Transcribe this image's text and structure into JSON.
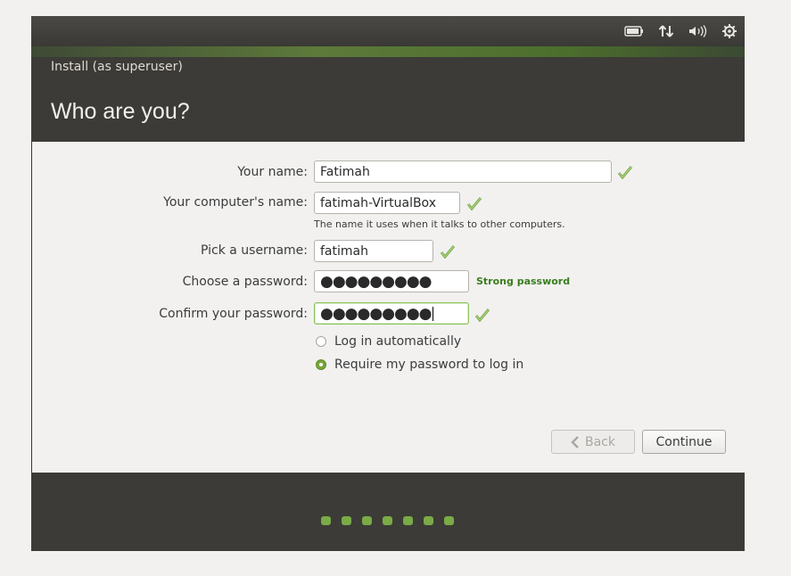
{
  "window": {
    "title": "Install (as superuser)"
  },
  "page": {
    "title": "Who are you?"
  },
  "indicators": {
    "battery": "battery-icon",
    "network": "network-updown-icon",
    "volume": "volume-icon",
    "settings": "gear-icon"
  },
  "form": {
    "your_name_label": "Your name:",
    "your_name_value": "Fatimah",
    "computer_name_label": "Your computer's name:",
    "computer_name_value": "fatimah-VirtualBox",
    "computer_name_hint": "The name it uses when it talks to other computers.",
    "username_label": "Pick a username:",
    "username_value": "fatimah",
    "password_label": "Choose a password:",
    "password_value": "●●●●●●●●●",
    "password_strength": "Strong password",
    "confirm_label": "Confirm your password:",
    "confirm_value": "●●●●●●●●●",
    "login_auto_label": "Log in automatically",
    "require_password_label": "Require my password to log in",
    "selected_login_option": "Require my password to log in"
  },
  "buttons": {
    "back": "Back",
    "continue": "Continue"
  },
  "progress": {
    "steps": 7
  },
  "colors": {
    "accent_green": "#7aab46",
    "dark": "#3c3b37",
    "strong_text": "#3a7d1e"
  }
}
